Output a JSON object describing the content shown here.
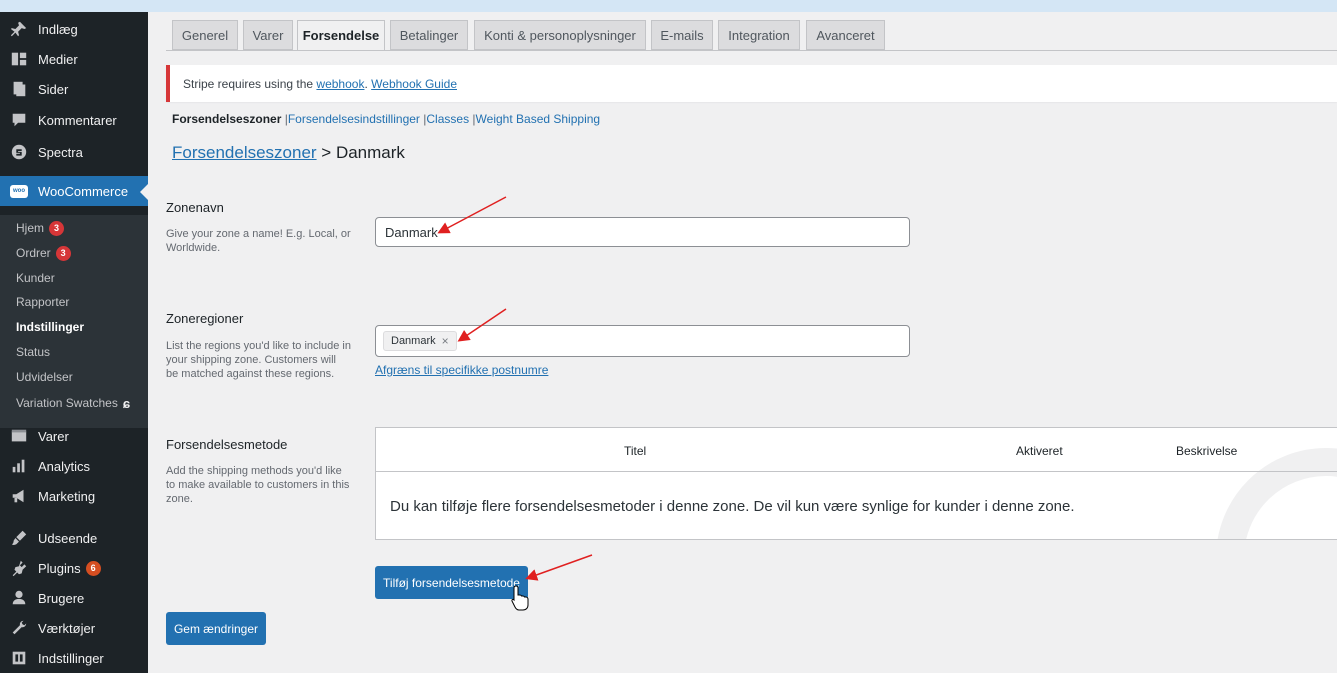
{
  "sidebar": {
    "items": [
      {
        "label": "Indlæg",
        "icon": "pin-icon"
      },
      {
        "label": "Medier",
        "icon": "media-icon"
      },
      {
        "label": "Sider",
        "icon": "pages-icon"
      },
      {
        "label": "Kommentarer",
        "icon": "comment-icon"
      },
      {
        "label": "Spectra",
        "icon": "spectra-icon"
      },
      {
        "label": "WooCommerce",
        "icon": "woo-icon"
      },
      {
        "label": "Varer",
        "icon": "products-icon"
      },
      {
        "label": "Analytics",
        "icon": "analytics-icon"
      },
      {
        "label": "Marketing",
        "icon": "marketing-icon"
      },
      {
        "label": "Udseende",
        "icon": "appearance-icon"
      },
      {
        "label": "Plugins",
        "icon": "plugins-icon",
        "badge": "6"
      },
      {
        "label": "Brugere",
        "icon": "users-icon"
      },
      {
        "label": "Værktøjer",
        "icon": "tools-icon"
      },
      {
        "label": "Indstillinger",
        "icon": "settings-icon"
      }
    ],
    "woo_logo_text": "woo",
    "submenu": [
      {
        "label": "Hjem",
        "badge": "3"
      },
      {
        "label": "Ordrer",
        "badge": "3"
      },
      {
        "label": "Kunder"
      },
      {
        "label": "Rapporter"
      },
      {
        "label": "Indstillinger"
      },
      {
        "label": "Status"
      },
      {
        "label": "Udvidelser"
      },
      {
        "label": "Variation Swatches"
      }
    ]
  },
  "tabs": [
    "Generel",
    "Varer",
    "Forsendelse",
    "Betalinger",
    "Konti & personoplysninger",
    "E-mails",
    "Integration",
    "Avanceret"
  ],
  "notice": {
    "text": "Stripe requires using the",
    "link1": "webhook",
    "sep": ".",
    "link2": "Webhook Guide"
  },
  "subnav": {
    "current": "Forsendelseszoner",
    "links": [
      "Forsendelsesindstillinger",
      "Classes",
      "Weight Based Shipping"
    ]
  },
  "heading": {
    "link": "Forsendelseszoner",
    "rest": " > Danmark"
  },
  "zone_name": {
    "label": "Zonenavn",
    "description": "Give your zone a name! E.g. Local, or Worldwide.",
    "value": "Danmark"
  },
  "zone_regions": {
    "label": "Zoneregioner",
    "description": "List the regions you'd like to include in your shipping zone. Customers will be matched against these regions.",
    "chip": "Danmark",
    "chip_remove": "×",
    "limit_link": "Afgræns til specifikke postnumre"
  },
  "shipping_methods": {
    "label": "Forsendelsesmetode",
    "description": "Add the shipping methods you'd like to make available to customers in this zone.",
    "columns": [
      "Titel",
      "Aktiveret",
      "Beskrivelse"
    ],
    "empty_text": "Du kan tilføje flere forsendelsesmetoder i denne zone. De vil kun være synlige for kunder i denne zone.",
    "add_button": "Tilføj forsendelsesmetode"
  },
  "save_button": "Gem ændringer",
  "colors": {
    "accent": "#2271b1",
    "sidebar": "#1d2327",
    "badge": "#d63638",
    "annotation": "#e02020"
  }
}
